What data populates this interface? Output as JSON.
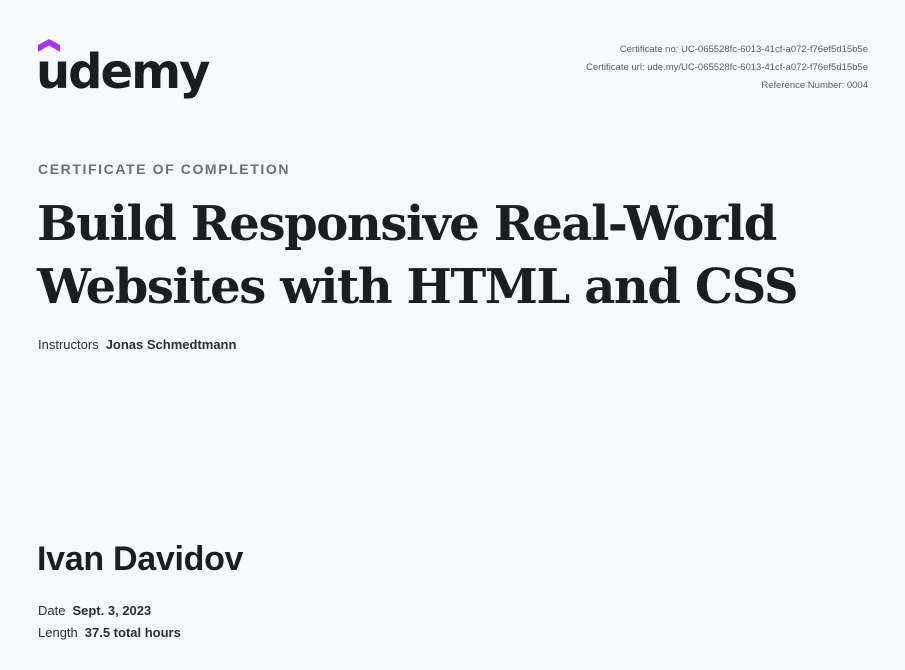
{
  "brand": {
    "wordmark": "udemy",
    "accent_color": "#a435f0"
  },
  "certificate_meta": {
    "certificate_no": "Certificate no: UC-065528fc-6013-41cf-a072-f76ef5d15b5e",
    "certificate_url": "Certificate url: ude.my/UC-065528fc-6013-41cf-a072-f76ef5d15b5e",
    "reference_number": "Reference Number: 0004"
  },
  "heading": {
    "eyebrow": "CERTIFICATE OF COMPLETION",
    "title_line_1": "Build Responsive Real-World",
    "title_line_2": "Websites with HTML and CSS"
  },
  "instructors": {
    "label": "Instructors",
    "name": "Jonas Schmedtmann"
  },
  "recipient": {
    "name": "Ivan Davidov"
  },
  "details": {
    "date_label": "Date",
    "date_value": "Sept. 3, 2023",
    "length_label": "Length",
    "length_value": "37.5 total hours"
  }
}
